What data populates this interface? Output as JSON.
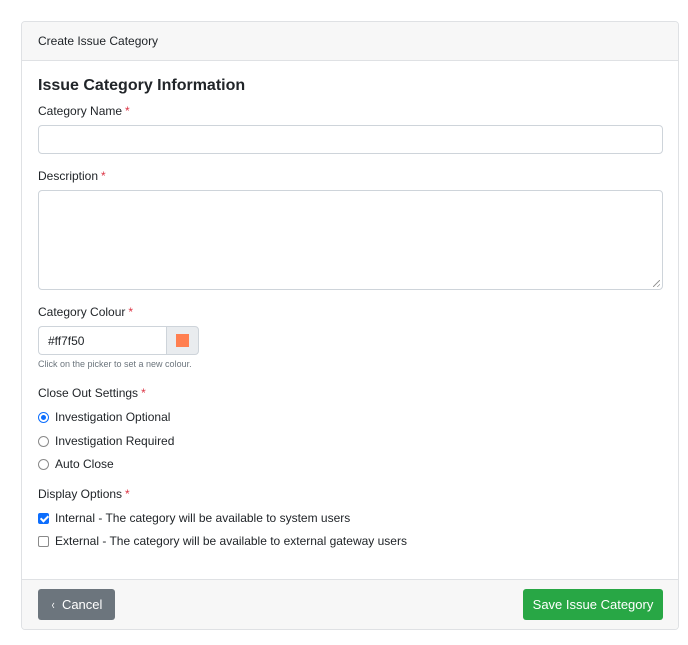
{
  "card": {
    "header_title": "Create Issue Category",
    "section_title": "Issue Category Information"
  },
  "required_marker": "*",
  "fields": {
    "category_name": {
      "label": "Category Name",
      "value": ""
    },
    "description": {
      "label": "Description",
      "value": ""
    },
    "category_colour": {
      "label": "Category Colour",
      "value": "#ff7f50",
      "swatch_color": "#ff7f50",
      "help": "Click on the picker to set a new colour."
    }
  },
  "close_out": {
    "label": "Close Out Settings",
    "options": [
      {
        "label": "Investigation Optional",
        "checked": true
      },
      {
        "label": "Investigation Required",
        "checked": false
      },
      {
        "label": "Auto Close",
        "checked": false
      }
    ]
  },
  "display_options": {
    "label": "Display Options",
    "options": [
      {
        "label": "Internal - The category will be available to system users",
        "checked": true
      },
      {
        "label": "External - The category will be available to external gateway users",
        "checked": false
      }
    ]
  },
  "footer": {
    "cancel_icon": "‹",
    "cancel_label": "Cancel",
    "save_label": "Save Issue Category"
  },
  "colors": {
    "primary": "#0d6efd",
    "secondary": "#6c757d",
    "success": "#28a745",
    "danger": "#dc3545"
  }
}
